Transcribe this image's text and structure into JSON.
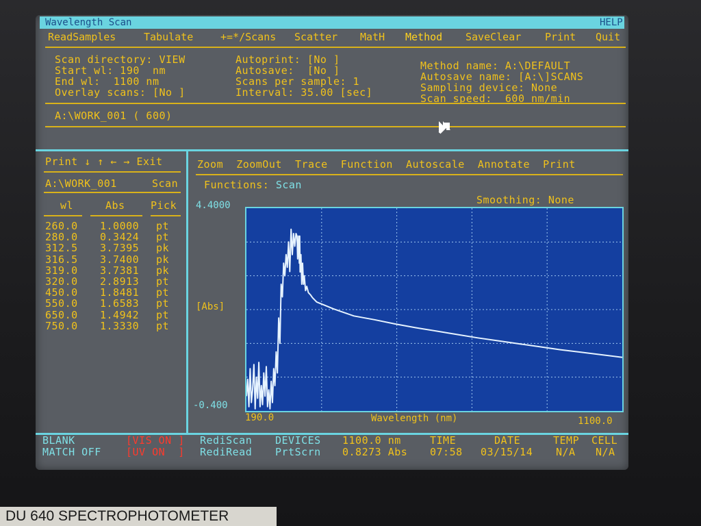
{
  "window": {
    "title": "Wavelength Scan",
    "help": "HELP"
  },
  "menu": [
    "ReadSamples",
    "Tabulate",
    "+=*/Scans",
    "Scatter",
    "MatH",
    "Method",
    "SaveClear",
    "Print",
    "Quit"
  ],
  "settings": {
    "col1": [
      "Scan directory: VIEW",
      "Start wl: 190  nm",
      "End wl:  1100 nm",
      "Overlay scans: [No ]"
    ],
    "col2": [
      "Autoprint: [No ]",
      "Autosave:  [No ]",
      "Scans per sample: 1",
      "Interval: 35.00 [sec]"
    ],
    "col3": [
      "Method name: A:\\DEFAULT",
      "Autosave name: [A:\\]SCANS",
      "Sampling device: None",
      "Scan speed:  600 nm/min"
    ]
  },
  "current_file": "A:\\WORK_001 ( 600)",
  "left_panel": {
    "menu": [
      "Print",
      "↓",
      "↑",
      "←",
      "→",
      "Exit"
    ],
    "file": "A:\\WORK_001",
    "file_right": "Scan",
    "headers": [
      "wl",
      "Abs",
      "Pick"
    ],
    "rows": [
      [
        "260.0",
        "1.0000",
        "pt"
      ],
      [
        "280.0",
        "0.3424",
        "pt"
      ],
      [
        "312.5",
        "3.7395",
        "pk"
      ],
      [
        "316.5",
        "3.7400",
        "pk"
      ],
      [
        "319.0",
        "3.7381",
        "pk"
      ],
      [
        "320.0",
        "2.8913",
        "pt"
      ],
      [
        "450.0",
        "1.8481",
        "pt"
      ],
      [
        "550.0",
        "1.6583",
        "pt"
      ],
      [
        "650.0",
        "1.4942",
        "pt"
      ],
      [
        "750.0",
        "1.3330",
        "pt"
      ]
    ]
  },
  "graph_panel": {
    "menu": [
      "Zoom",
      "ZoomOut",
      "Trace",
      "Function",
      "Autoscale",
      "Annotate",
      "Print"
    ],
    "functions_label": "Functions:",
    "functions_value": "Scan",
    "smoothing": "Smoothing: None",
    "ymax_label": "4.4000",
    "ymin_label": "-0.400",
    "ylabel": "[Abs]",
    "xmin_label": "190.0",
    "xmax_label": "1100.0",
    "xlabel": "Wavelength (nm)"
  },
  "chart_data": {
    "type": "line",
    "xlim": [
      190,
      1100
    ],
    "ylim": [
      -0.4,
      4.4
    ],
    "grid": true,
    "series": [
      {
        "values": [
          [
            190,
            -0.05
          ],
          [
            193,
            0.35
          ],
          [
            196,
            -0.3
          ],
          [
            199,
            0.6
          ],
          [
            202,
            -0.2
          ],
          [
            205,
            0.1
          ],
          [
            208,
            0.7
          ],
          [
            211,
            -0.35
          ],
          [
            214,
            0.4
          ],
          [
            217,
            -0.1
          ],
          [
            220,
            0.75
          ],
          [
            223,
            -0.3
          ],
          [
            226,
            0.2
          ],
          [
            229,
            -0.25
          ],
          [
            232,
            0.5
          ],
          [
            235,
            -0.05
          ],
          [
            238,
            0.65
          ],
          [
            241,
            -0.3
          ],
          [
            244,
            0.1
          ],
          [
            247,
            -0.35
          ],
          [
            250,
            0.3
          ],
          [
            253,
            -0.2
          ],
          [
            256,
            0.6
          ],
          [
            259,
            0.2
          ],
          [
            262,
            1.0
          ],
          [
            265,
            0.5
          ],
          [
            268,
            1.8
          ],
          [
            271,
            1.2
          ],
          [
            274,
            2.6
          ],
          [
            277,
            2.3
          ],
          [
            280,
            3.1
          ],
          [
            283,
            2.8
          ],
          [
            286,
            3.3
          ],
          [
            289,
            3.0
          ],
          [
            292,
            3.6
          ],
          [
            295,
            2.9
          ],
          [
            298,
            3.9
          ],
          [
            301,
            3.3
          ],
          [
            304,
            3.8
          ],
          [
            307,
            3.5
          ],
          [
            310,
            3.8
          ],
          [
            312.5,
            3.74
          ],
          [
            314,
            3.2
          ],
          [
            316.5,
            3.74
          ],
          [
            318,
            3.1
          ],
          [
            319,
            3.74
          ],
          [
            320,
            2.89
          ],
          [
            322,
            3.3
          ],
          [
            324,
            2.6
          ],
          [
            326,
            3.1
          ],
          [
            328,
            2.6
          ],
          [
            330,
            2.8
          ],
          [
            333,
            2.45
          ],
          [
            336,
            2.55
          ],
          [
            340,
            2.4
          ],
          [
            345,
            2.35
          ],
          [
            350,
            2.28
          ],
          [
            360,
            2.18
          ],
          [
            370,
            2.14
          ],
          [
            380,
            2.1
          ],
          [
            400,
            2.02
          ],
          [
            420,
            1.95
          ],
          [
            450,
            1.85
          ],
          [
            500,
            1.76
          ],
          [
            550,
            1.66
          ],
          [
            600,
            1.57
          ],
          [
            650,
            1.49
          ],
          [
            700,
            1.41
          ],
          [
            750,
            1.33
          ],
          [
            800,
            1.26
          ],
          [
            850,
            1.19
          ],
          [
            900,
            1.12
          ],
          [
            950,
            1.05
          ],
          [
            1000,
            0.99
          ],
          [
            1050,
            0.93
          ],
          [
            1100,
            0.87
          ]
        ]
      }
    ]
  },
  "status_bar": {
    "blank": "BLANK",
    "match": "MATCH OFF",
    "vis": "[VIS ON ]",
    "uv": "[UV ON  ]",
    "rediscan": "RediScan",
    "rediread": "RediRead",
    "devices": "DEVICES",
    "prtscrn": "PrtScrn",
    "wl_value": "1100.0 nm",
    "abs_value": "0.8273 Abs",
    "time_label": "TIME",
    "time_value": "07:58",
    "date_label": "DATE",
    "date_value": "03/15/14",
    "temp_label": "TEMP",
    "temp_value": "N/A",
    "cell_label": "CELL",
    "cell_value": "N/A"
  },
  "device_label": "DU 640 SPECTROPHOTOMETER",
  "colors": {
    "text": "#f1c21b",
    "accent": "#6ad4e0",
    "plot_bg": "#143fa0",
    "trace": "#e6f3ff",
    "alert": "#ff3a2c"
  }
}
